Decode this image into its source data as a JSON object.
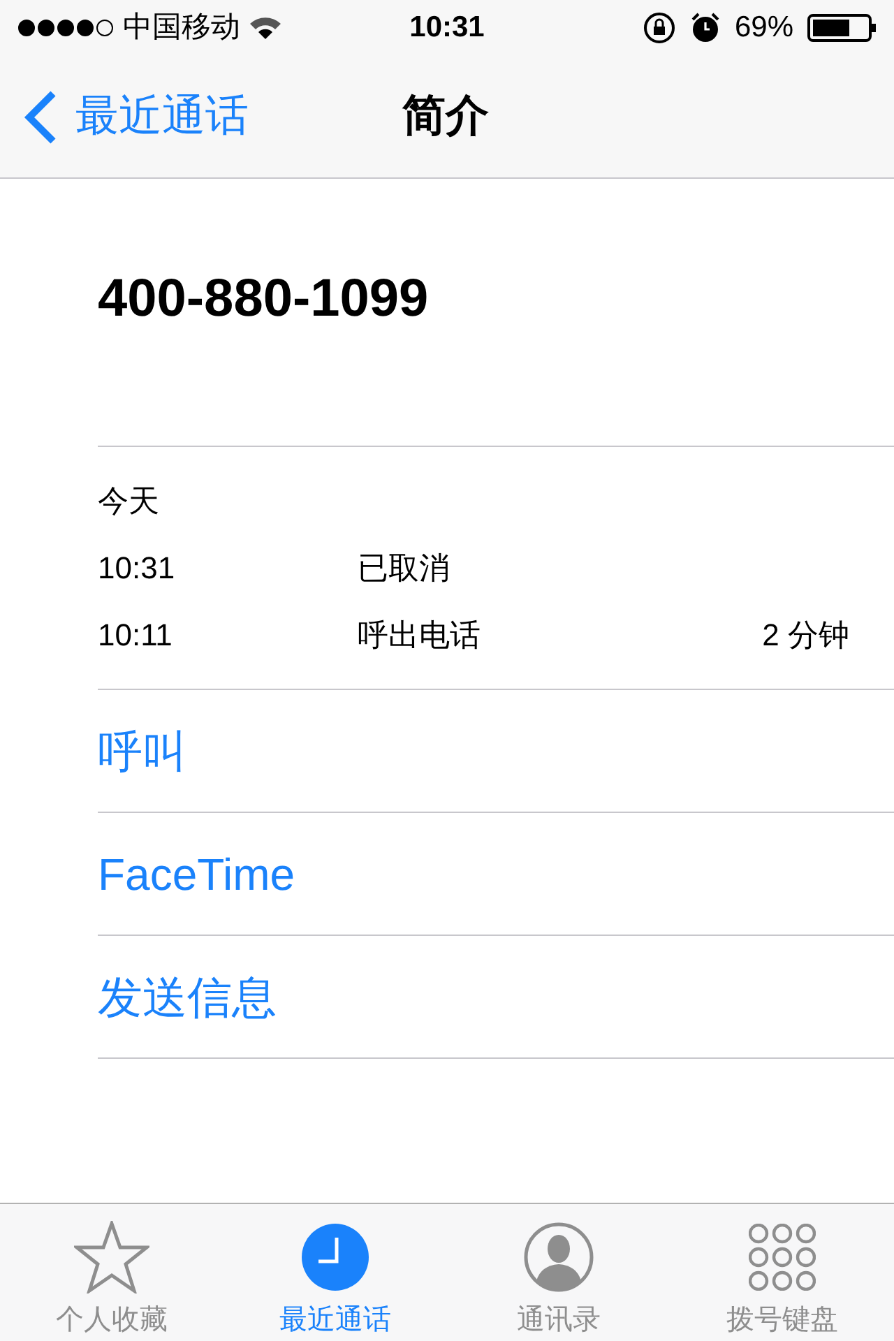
{
  "status_bar": {
    "carrier": "中国移动",
    "time": "10:31",
    "battery_text": "69%"
  },
  "nav": {
    "back": "最近通话",
    "title": "简介"
  },
  "contact": {
    "number": "400-880-1099"
  },
  "calls": {
    "heading": "今天",
    "rows": [
      {
        "time": "10:31",
        "type": "已取消"
      },
      {
        "time": "10:11",
        "type": "呼出电话",
        "duration": "2 分钟"
      }
    ]
  },
  "actions": [
    "呼叫",
    "FaceTime",
    "发送信息"
  ],
  "tabs": [
    {
      "kind": "star",
      "label": "个人收藏",
      "selected": false
    },
    {
      "kind": "clock",
      "label": "最近通话",
      "selected": true
    },
    {
      "kind": "person",
      "label": "通讯录",
      "selected": false
    },
    {
      "kind": "keypad",
      "label": "拨号键盘",
      "selected": false
    }
  ]
}
